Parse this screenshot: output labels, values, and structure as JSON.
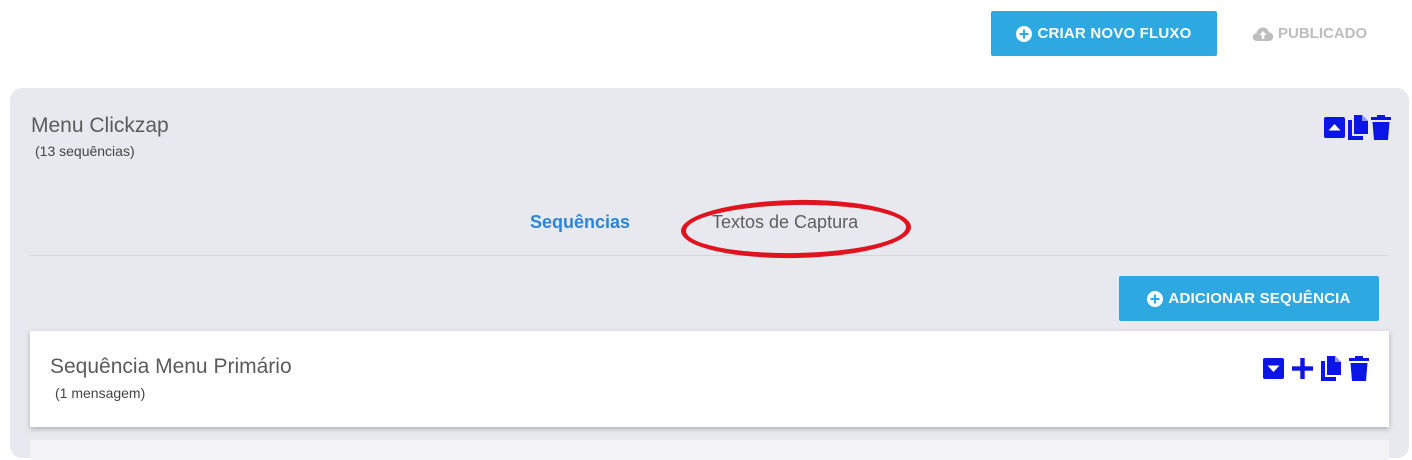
{
  "toolbar": {
    "create_flow_label": "CRIAR NOVO FLUXO",
    "published_label": "PUBLICADO"
  },
  "flow": {
    "title": "Menu Clickzap",
    "subtitle": "(13 sequências)",
    "actions": [
      "collapse-up-icon",
      "copy-icon",
      "trash-icon"
    ],
    "tabs": [
      {
        "label": "Sequências",
        "active": true
      },
      {
        "label": "Textos de Captura",
        "active": false
      }
    ],
    "add_sequence_label": "ADICIONAR SEQUÊNCIA",
    "sequences": [
      {
        "title": "Sequência Menu Primário",
        "subtitle": "(1 mensagem)",
        "actions": [
          "expand-down-icon",
          "plus-icon",
          "copy-icon",
          "trash-icon"
        ]
      }
    ]
  },
  "colors": {
    "accent": "#2ea8e0",
    "active_tab": "#2b86d6",
    "icon_blue": "#0b16e6",
    "highlight_ring": "#e0141f",
    "panel_bg": "#e8e9ee",
    "published_gray": "#bdbdbd"
  }
}
